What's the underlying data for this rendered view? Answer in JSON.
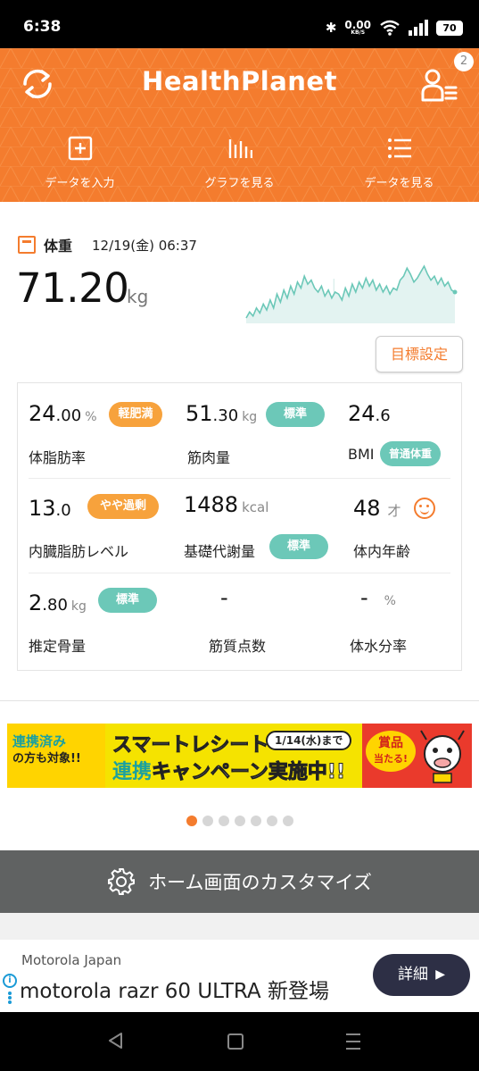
{
  "status_bar": {
    "time": "6:38",
    "net_speed": "0.00",
    "net_unit": "KB/S",
    "battery": "70"
  },
  "header": {
    "title": "HealthPlanet",
    "notification_count": "2",
    "actions": [
      {
        "label": "データを入力",
        "icon": "plus-square-icon"
      },
      {
        "label": "グラフを見る",
        "icon": "bar-graph-icon"
      },
      {
        "label": "データを見る",
        "icon": "list-icon"
      }
    ]
  },
  "weight": {
    "label": "体重",
    "date": "12/19(金) 06:37",
    "value": "71.20",
    "unit": "kg",
    "goal_button": "目標設定",
    "trend": [
      20,
      26,
      22,
      30,
      25,
      34,
      28,
      38,
      30,
      44,
      36,
      48,
      40,
      52,
      44,
      56,
      50,
      62,
      54,
      58,
      50,
      46,
      52,
      42,
      48,
      40,
      46,
      44,
      38,
      50,
      42,
      54,
      46,
      56,
      50,
      60,
      52,
      58,
      48,
      54,
      46,
      52,
      44,
      50,
      48,
      58,
      62,
      70,
      64,
      56,
      60,
      66,
      72,
      64,
      58,
      62,
      54,
      60,
      52,
      56,
      48,
      46
    ]
  },
  "metrics": {
    "body_fat": {
      "int": "24",
      "dec": ".00",
      "unit": "%",
      "label": "体脂肪率",
      "status": "軽肥満"
    },
    "muscle": {
      "int": "51",
      "dec": ".30",
      "unit": "kg",
      "label": "筋肉量",
      "status": "標準"
    },
    "bmi": {
      "int": "24",
      "dec": ".6",
      "label": "BMI",
      "status": "普通体重"
    },
    "visceral": {
      "int": "13",
      "dec": ".0",
      "label": "内臓脂肪レベル",
      "status": "やや過剰"
    },
    "bmr": {
      "value": "1488",
      "unit": "kcal",
      "label": "基礎代謝量",
      "status": "標準"
    },
    "body_age": {
      "value": "48",
      "unit": "才",
      "label": "体内年齢"
    },
    "bone": {
      "int": "2",
      "dec": ".80",
      "unit": "kg",
      "label": "推定骨量",
      "status": "標準"
    },
    "muscle_quality": {
      "value": "-",
      "label": "筋質点数"
    },
    "water": {
      "value": "-",
      "unit": "%",
      "label": "体水分率"
    }
  },
  "banner": {
    "left_line1": "連携済み",
    "left_line2": "の方も対象!!",
    "line1": "スマートレシート",
    "date": "1/14(水)まで",
    "line2_highlight": "連携",
    "line2_rest": "キャンペーン実施中!!",
    "prize_line1": "賞品",
    "prize_line2": "当たる!",
    "page_count": 7,
    "active_page": 0
  },
  "customize": {
    "label": "ホーム画面のカスタマイズ"
  },
  "ad": {
    "sponsor": "Motorola Japan",
    "title": "motorola razr 60 ULTRA 新登場",
    "button": "詳細"
  },
  "colors": {
    "brand_orange": "#f47c2e",
    "teal": "#6cc8b8",
    "status_orange": "#f7a23c",
    "gray_bar": "#606262"
  }
}
